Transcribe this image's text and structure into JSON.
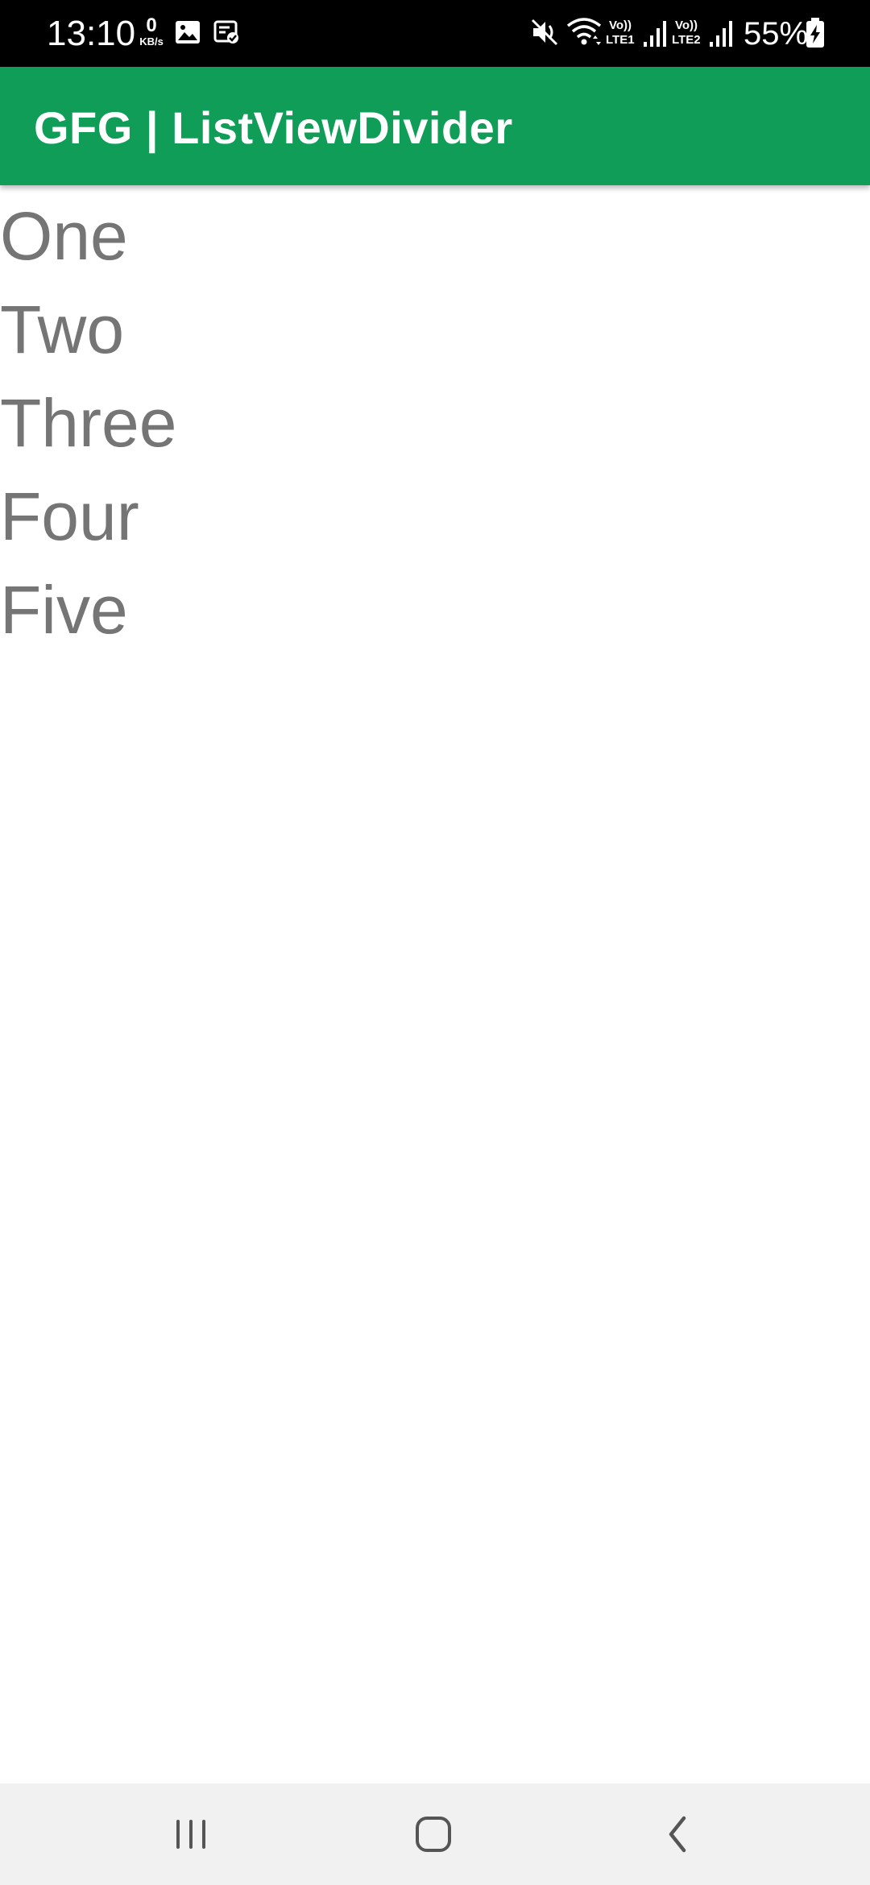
{
  "status_bar": {
    "time": "13:10",
    "net_speed_value": "0",
    "net_speed_unit": "KB/s",
    "icons": [
      "image-icon",
      "notification-check-icon",
      "mute-icon",
      "wifi-icon",
      "signal-icon",
      "signal-icon",
      "battery-charging-icon"
    ],
    "sim1_label_top": "Vo))",
    "sim1_label_bottom": "LTE1",
    "sim2_label_top": "Vo))",
    "sim2_label_bottom": "LTE2",
    "battery": "55%"
  },
  "app_bar": {
    "title": "GFG | ListViewDivider",
    "color": "#0f9d58"
  },
  "list": {
    "items": [
      "One",
      "Two",
      "Three",
      "Four",
      "Five"
    ],
    "text_color": "#757575"
  },
  "nav_bar": {
    "buttons": [
      "recent-apps-icon",
      "home-icon",
      "back-icon"
    ]
  }
}
